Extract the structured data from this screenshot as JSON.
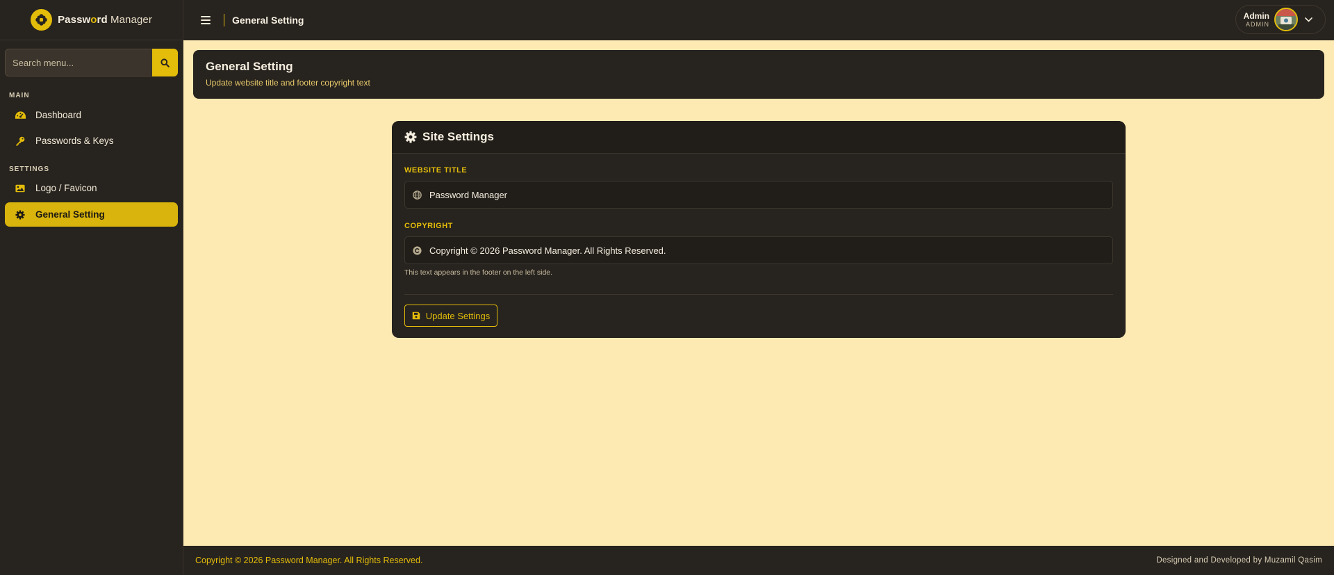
{
  "brand": {
    "part1": "Passw",
    "part2": "o",
    "part3": "rd",
    "part4": " Manager"
  },
  "search": {
    "placeholder": "Search menu..."
  },
  "sidebar": {
    "sections": [
      {
        "label": "MAIN"
      },
      {
        "label": "SETTINGS"
      }
    ],
    "items": [
      {
        "label": "Dashboard",
        "icon": "dashboard-icon"
      },
      {
        "label": "Passwords & Keys",
        "icon": "key-icon"
      },
      {
        "label": "Logo / Favicon",
        "icon": "image-icon"
      },
      {
        "label": "General Setting",
        "icon": "gear-icon",
        "active": true
      }
    ]
  },
  "topbar": {
    "title": "General Setting"
  },
  "user": {
    "name": "Admin",
    "role": "ADMIN"
  },
  "page": {
    "title": "General Setting",
    "subtitle": "Update website title and footer copyright text"
  },
  "card": {
    "title": "Site Settings",
    "website_title_label": "WEBSITE TITLE",
    "website_title_value": "Password Manager",
    "copyright_label": "COPYRIGHT",
    "copyright_value": "Copyright © 2026 Password Manager. All Rights Reserved.",
    "help": "This text appears in the footer on the left side.",
    "button": "Update Settings"
  },
  "footer": {
    "left": "Copyright © 2026 Password Manager. All Rights Reserved.",
    "right": "Designed and Developed by Muzamil Qasim"
  },
  "colors": {
    "accent": "#e4bd0a",
    "background": "#fdeab2",
    "panel": "#27231f"
  }
}
